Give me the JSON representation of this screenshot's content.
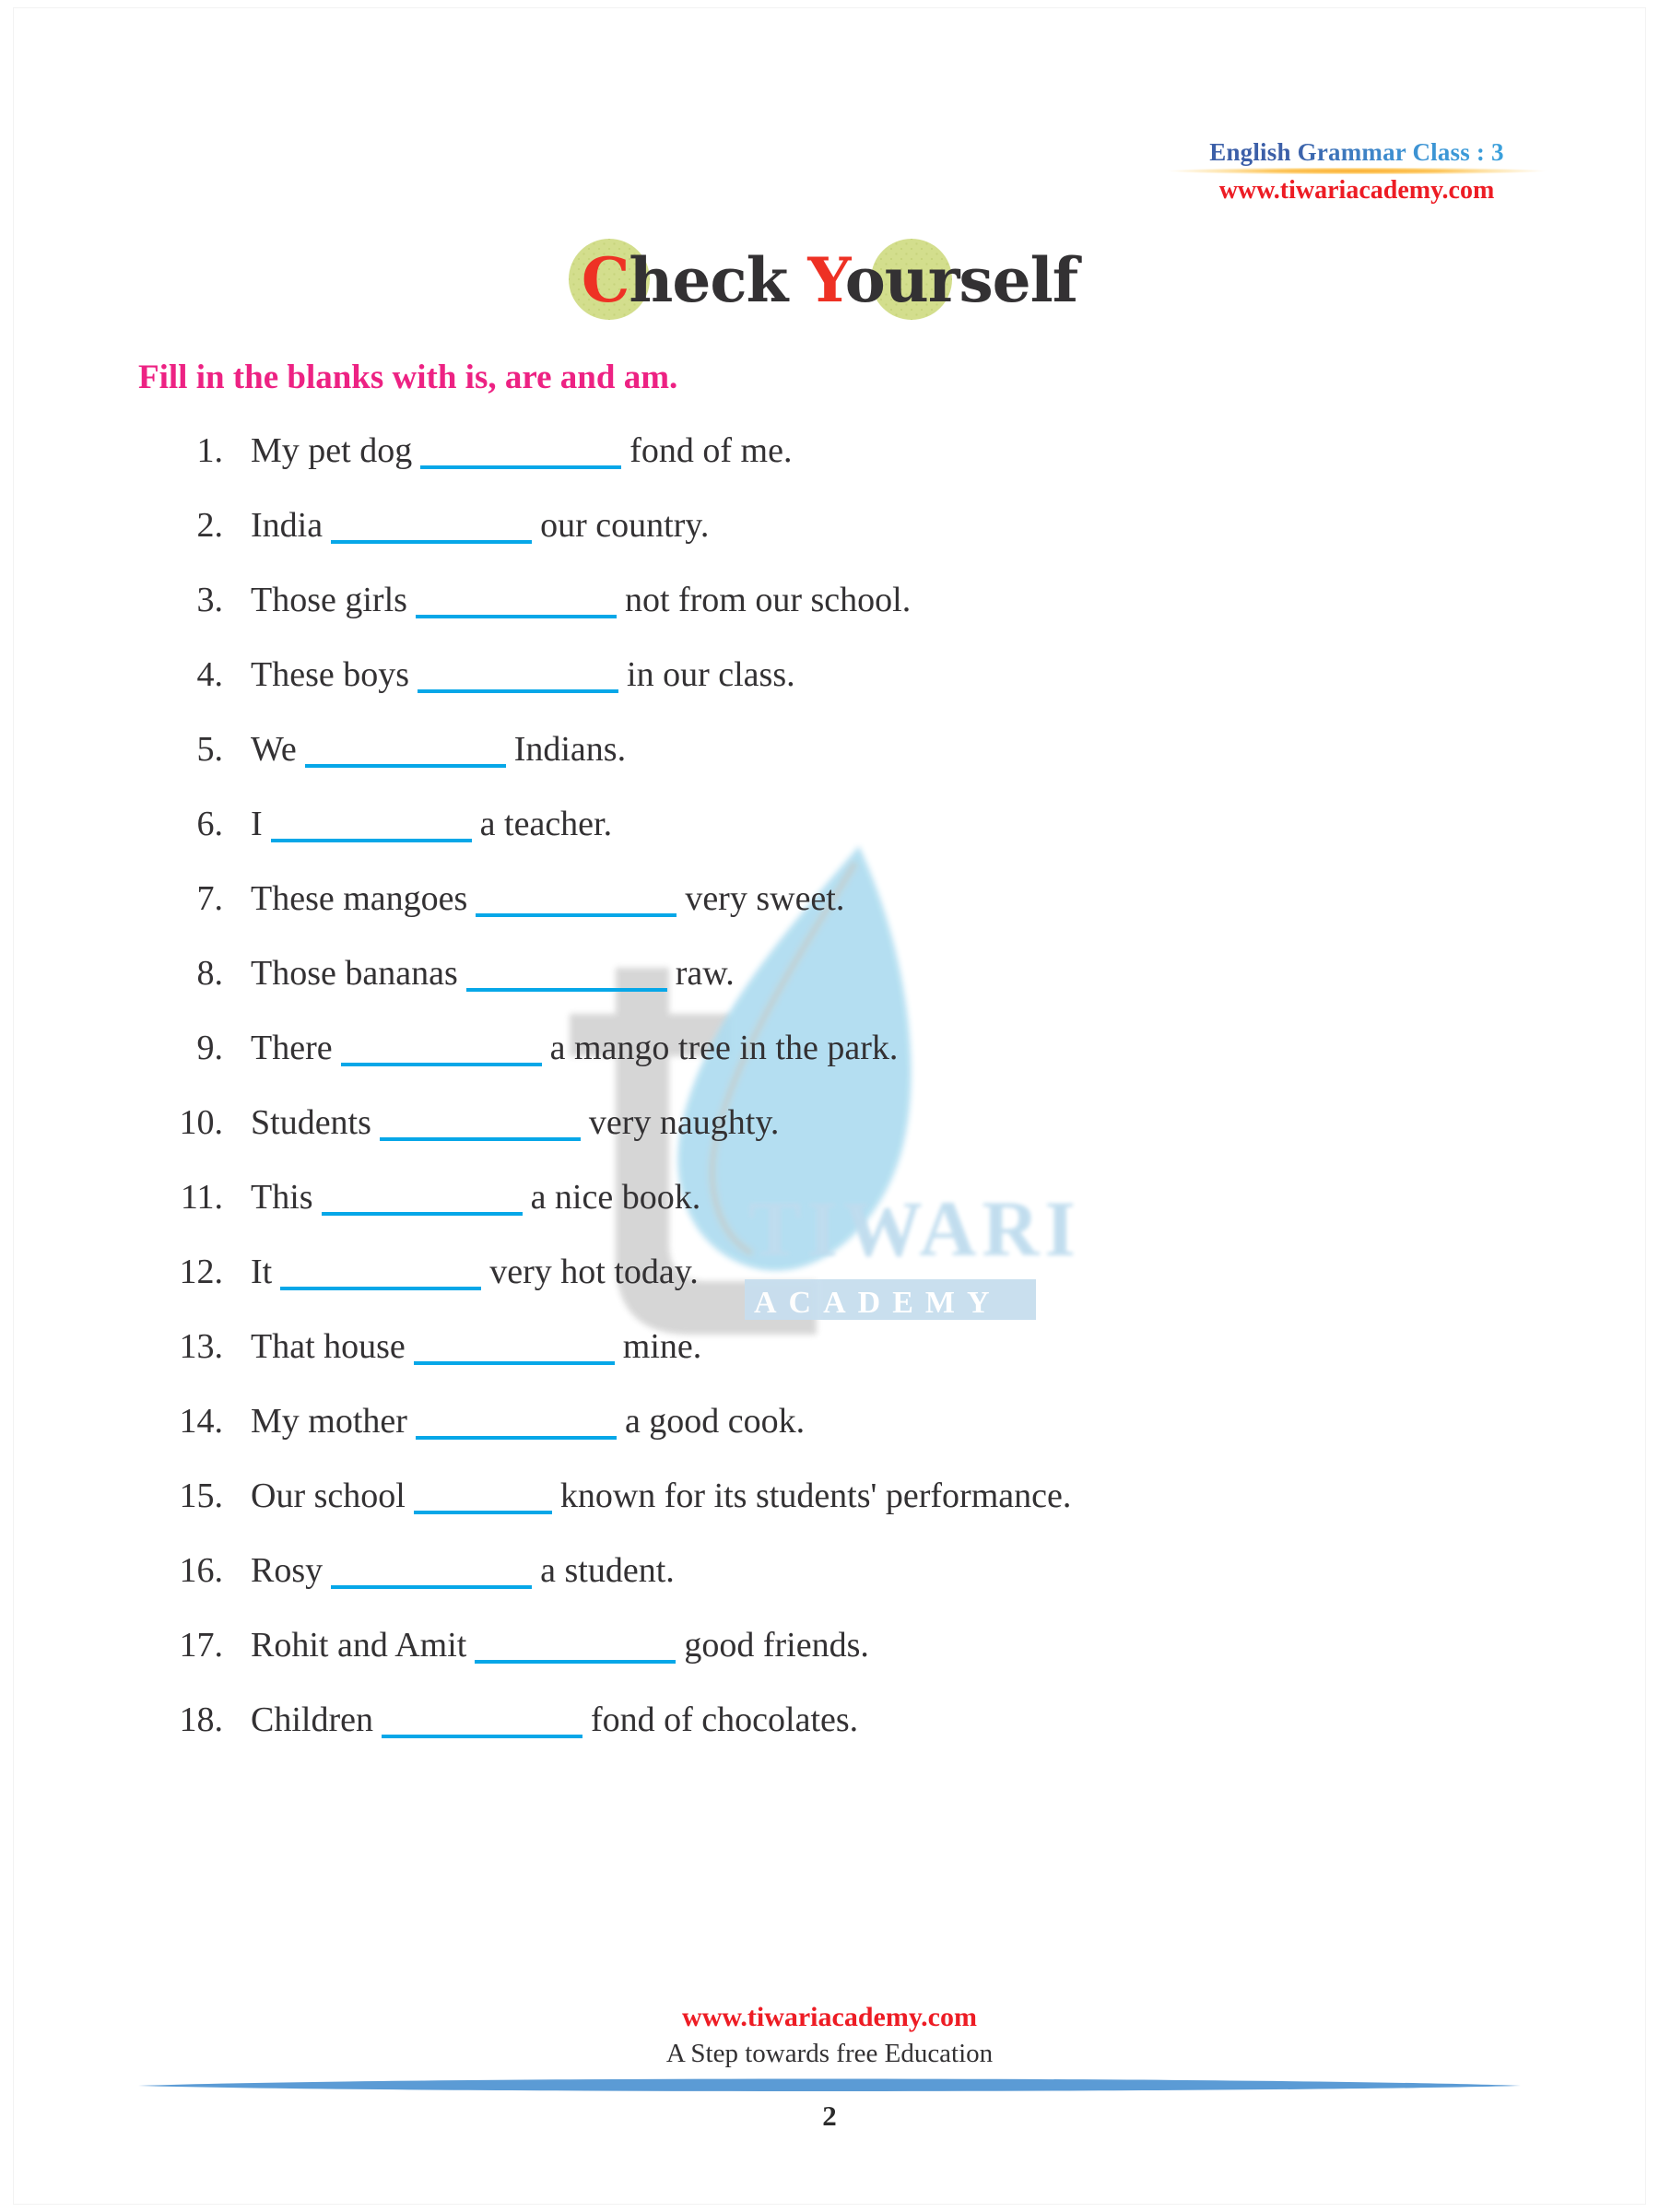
{
  "header": {
    "class_line": "English Grammar Class : 3",
    "website": "www.tiwariacademy.com",
    "class_color": "#3E73B8",
    "website_color": "#ED1C24",
    "rule_color": "#FBB034"
  },
  "title": {
    "word1_cap": "C",
    "word1_rest": "heck",
    "word2_cap": "Y",
    "word2_rest": "ourself",
    "full": "Check Yourself",
    "cap_color": "#EE3124",
    "text_color": "#333133",
    "blob_color": "#D3DE8D"
  },
  "instruction": {
    "text": "Fill in the blanks with is, are and am.",
    "color": "#ED2283"
  },
  "blank_color": "#06A7E8",
  "questions": [
    {
      "num": "1.",
      "before": "My pet dog",
      "blank": "long",
      "after": "fond of me."
    },
    {
      "num": "2.",
      "before": "India",
      "blank": "long",
      "after": "our country."
    },
    {
      "num": "3.",
      "before": "Those girls",
      "blank": "long",
      "after": "not from our school."
    },
    {
      "num": "4.",
      "before": "These boys",
      "blank": "long",
      "after": "in our class."
    },
    {
      "num": "5.",
      "before": "We",
      "blank": "long",
      "after": "Indians."
    },
    {
      "num": "6.",
      "before": "I",
      "blank": "long",
      "after": "a teacher."
    },
    {
      "num": "7.",
      "before": "These mangoes",
      "blank": "long",
      "after": "very sweet."
    },
    {
      "num": "8.",
      "before": "Those bananas",
      "blank": "long",
      "after": "raw."
    },
    {
      "num": "9.",
      "before": "There",
      "blank": "long",
      "after": "a mango tree in the park."
    },
    {
      "num": "10.",
      "before": "Students",
      "blank": "long",
      "after": "very naughty."
    },
    {
      "num": "11.",
      "before": "This",
      "blank": "long",
      "after": "a nice book."
    },
    {
      "num": "12.",
      "before": "It",
      "blank": "long",
      "after": "very hot today."
    },
    {
      "num": "13.",
      "before": "That house",
      "blank": "long",
      "after": "mine."
    },
    {
      "num": "14.",
      "before": "My mother",
      "blank": "long",
      "after": "a good cook."
    },
    {
      "num": "15.",
      "before": "Our school",
      "blank": "short",
      "after": "known for its students' performance."
    },
    {
      "num": "16.",
      "before": "Rosy",
      "blank": "long",
      "after": "a student."
    },
    {
      "num": "17.",
      "before": "Rohit and Amit",
      "blank": "long",
      "after": "good friends."
    },
    {
      "num": "18.",
      "before": "Children",
      "blank": "long",
      "after": "fond of chocolates."
    }
  ],
  "watermark": {
    "letter": "t",
    "brand_line1": "TIWARI",
    "brand_line2": "ACADEMY",
    "leaf_color": "#AEDDF0",
    "letter_color": "#C9C9C9",
    "brand_color": "#BFDDEE"
  },
  "footer": {
    "website": "www.tiwariacademy.com",
    "tagline": "A Step towards free Education",
    "page_number": "2",
    "rule_color": "#5B9BD5"
  }
}
